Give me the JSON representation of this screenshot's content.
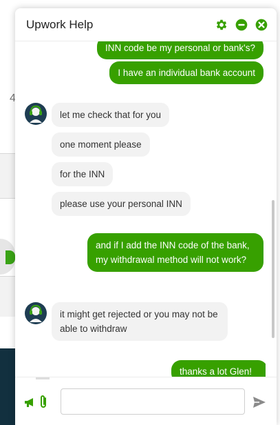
{
  "header": {
    "title": "Upwork Help"
  },
  "background": {
    "partial_digit": "4"
  },
  "messages": [
    {
      "sender": "user",
      "text": "INN code be my personal or bank's?"
    },
    {
      "sender": "user",
      "text": "I have an individual bank account"
    },
    {
      "sender": "agent",
      "text": "let me check that for you"
    },
    {
      "sender": "agent",
      "text": "one moment please"
    },
    {
      "sender": "agent",
      "text": "for the INN"
    },
    {
      "sender": "agent",
      "text": "please use your personal INN"
    },
    {
      "sender": "user",
      "text": "and if I add the INN code of the bank, my withdrawal method will not work?"
    },
    {
      "sender": "agent",
      "text": "it might get rejected or you may not be able to withdraw"
    },
    {
      "sender": "user",
      "text": "thanks a lot Glen!"
    }
  ],
  "composer": {
    "placeholder": "",
    "value": ""
  },
  "colors": {
    "accent": "#37a000",
    "agent_bubble": "#f2f2f2",
    "avatar_bg": "#1e3d52"
  },
  "icons": {
    "settings": "gear-icon",
    "minimize": "minus-circle-icon",
    "close": "close-circle-icon",
    "announce": "megaphone-icon",
    "attach": "paperclip-icon",
    "send": "send-icon"
  }
}
